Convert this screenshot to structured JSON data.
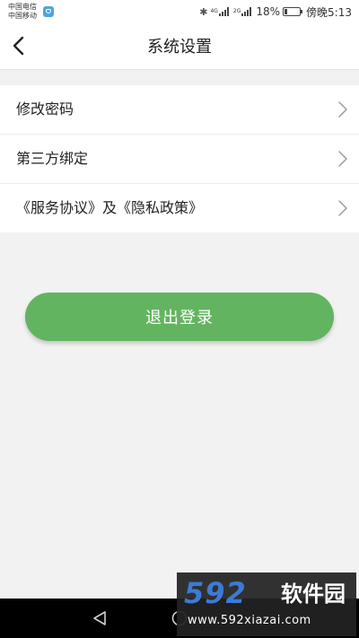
{
  "status_bar": {
    "carrier_1": "中国电信",
    "carrier_2": "中国移动",
    "network_1": "4G",
    "network_2": "2G",
    "battery_percent": "18%",
    "battery_level": 0.18,
    "time": "傍晚5:13"
  },
  "nav": {
    "title": "系统设置"
  },
  "menu": {
    "items": [
      {
        "label": "修改密码"
      },
      {
        "label": "第三方绑定"
      },
      {
        "label": "《服务协议》及《隐私政策》"
      }
    ]
  },
  "logout": {
    "label": "退出登录"
  },
  "watermark": {
    "logo": "592",
    "name": "软件园",
    "url": "www.592xiazai.com"
  },
  "colors": {
    "accent_green": "#63b460",
    "background": "#f2f2f2",
    "watermark_blue": "#3d7ad6"
  }
}
